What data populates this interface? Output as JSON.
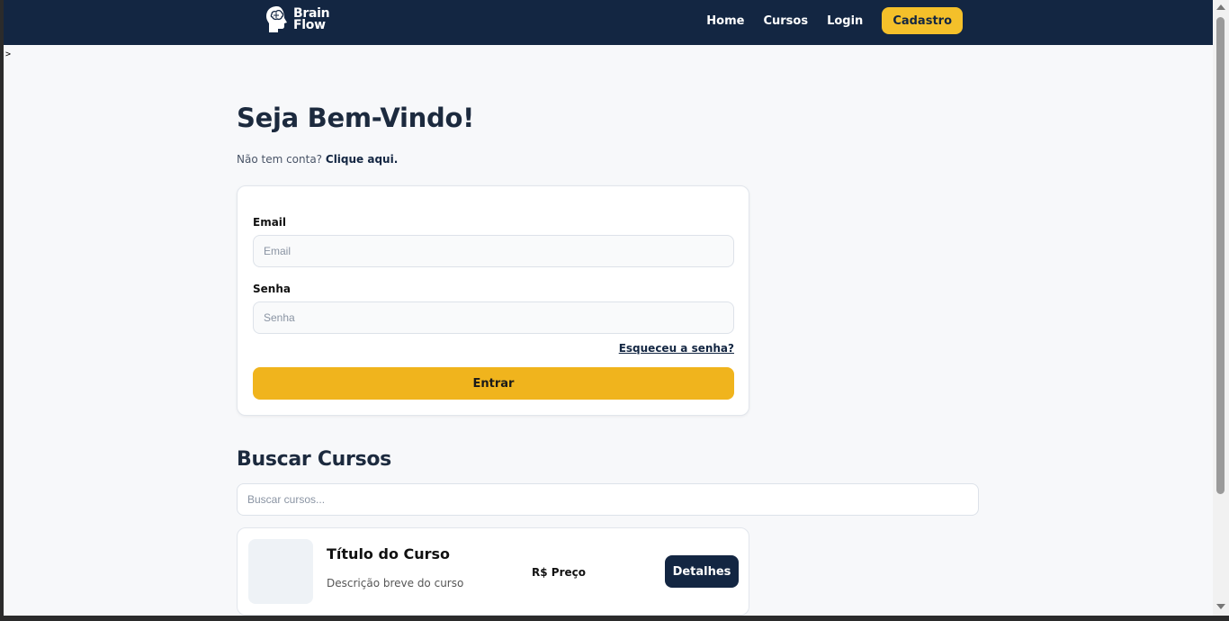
{
  "nav": {
    "logo": {
      "line1": "Brain",
      "line2": "Flow"
    },
    "links": [
      "Home",
      "Cursos",
      "Login"
    ],
    "cta": "Cadastro"
  },
  "stray_text": ">",
  "login": {
    "title": "Seja Bem-Vindo!",
    "no_account": "Não tem conta?",
    "click_here": "Clique aqui.",
    "email_label": "Email",
    "email_placeholder": "Email",
    "password_label": "Senha",
    "password_placeholder": "Senha",
    "forgot": "Esqueceu a senha?",
    "submit": "Entrar"
  },
  "search": {
    "title": "Buscar Cursos",
    "placeholder": "Buscar cursos..."
  },
  "course": {
    "title": "Título do Curso",
    "description": "Descrição breve do curso",
    "price": "R$ Preço",
    "details_button": "Detalhes"
  },
  "colors": {
    "navbar": "#132642",
    "accent": "#f0b41d",
    "cta": "#f4c02a",
    "page_bg": "#f7f8fa"
  },
  "icons": {
    "logo": "brain-head-icon"
  }
}
